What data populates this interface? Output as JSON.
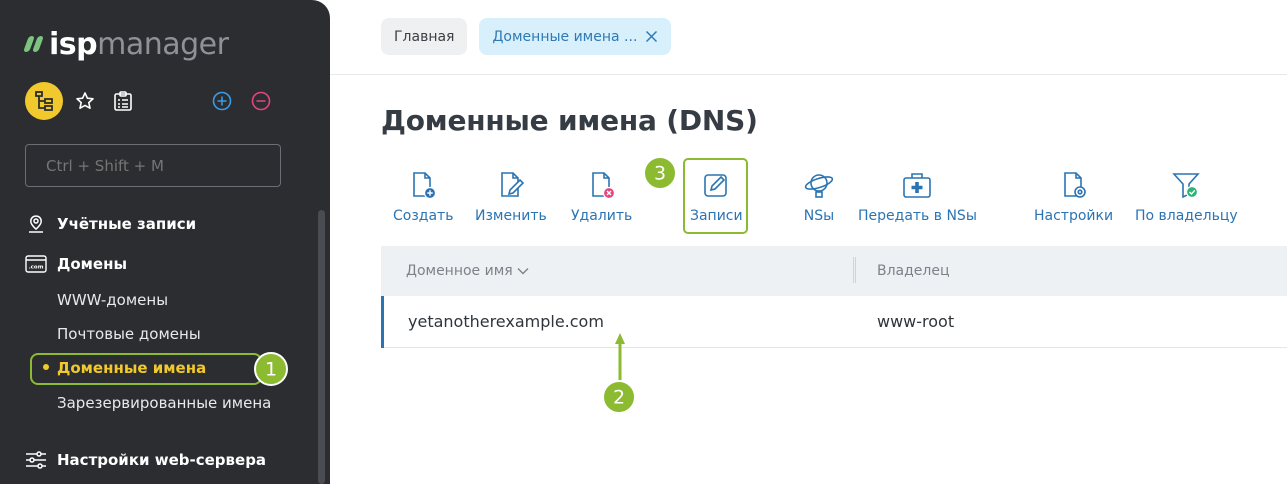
{
  "app": {
    "logo_primary": "isp",
    "logo_secondary": "manager"
  },
  "sidebar": {
    "search_placeholder": "Ctrl + Shift + M",
    "sections": [
      {
        "label": "Учётные записи"
      },
      {
        "label": "Домены"
      },
      {
        "label": "Настройки web-сервера"
      }
    ],
    "domain_items": [
      {
        "label": "WWW-домены"
      },
      {
        "label": "Почтовые домены"
      },
      {
        "label": "Доменные имена",
        "active": true
      },
      {
        "label": "Зарезервированные имена"
      }
    ]
  },
  "breadcrumbs": {
    "home": "Главная",
    "current": "Доменные имена ..."
  },
  "page": {
    "title": "Доменные имена (DNS)"
  },
  "toolbar": {
    "create": "Создать",
    "edit": "Изменить",
    "delete": "Удалить",
    "records": "Записи",
    "ns": "NSы",
    "transfer_ns": "Передать в NSы",
    "settings": "Настройки",
    "by_owner": "По владельцу"
  },
  "table": {
    "columns": [
      "Доменное имя",
      "Владелец"
    ],
    "rows": [
      {
        "domain": "yetanotherexample.com",
        "owner": "www-root"
      }
    ]
  },
  "annotations": {
    "step1": "1",
    "step2": "2",
    "step3": "3"
  },
  "colors": {
    "sidebar_bg": "#2b2d31",
    "accent_yellow": "#f2c92c",
    "accent_blue": "#2b74b3",
    "annotation_green": "#8cbb32"
  }
}
